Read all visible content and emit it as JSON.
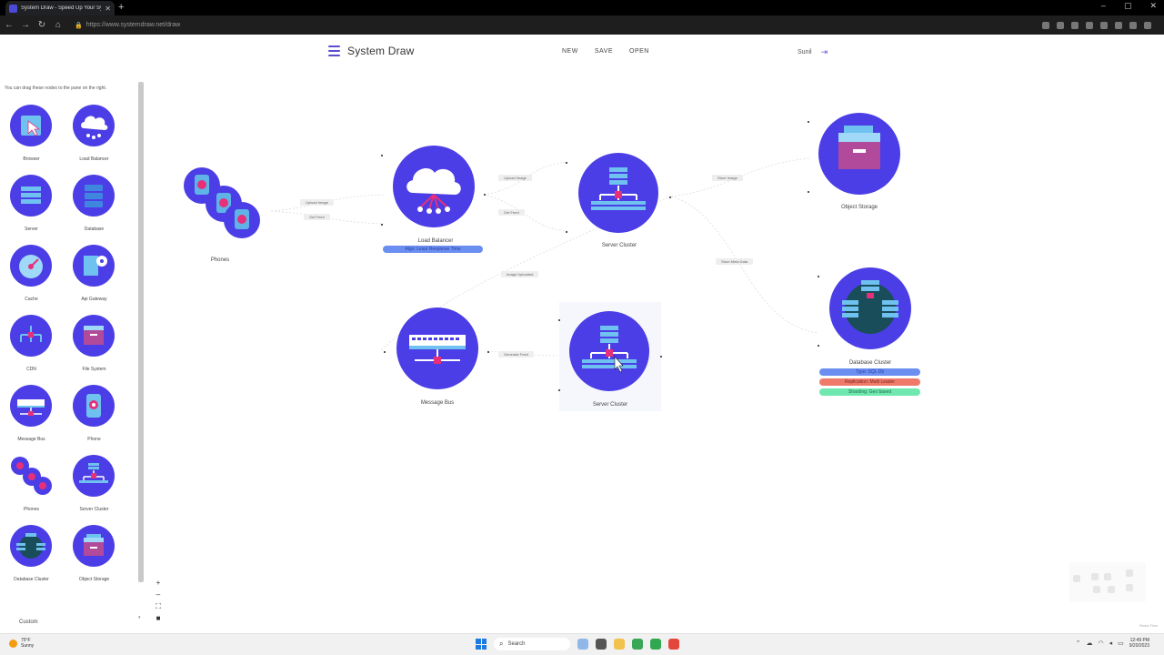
{
  "browser": {
    "tab_title": "System Draw - Speed Up Your Sy",
    "url": "https://www.systemdraw.net/draw",
    "new_tab": "+",
    "minimize": "–",
    "maximize": "▢",
    "close": "✕",
    "tab_close": "✕",
    "back": "←",
    "forward": "→",
    "reload": "↻",
    "home": "⌂"
  },
  "header": {
    "app_name": "System Draw",
    "menu": {
      "new": "NEW",
      "save": "SAVE",
      "open": "OPEN"
    },
    "user": "Sunil",
    "logout_icon": "⇥"
  },
  "sidebar": {
    "hint": "You can drag these nodes to the pane on the right.",
    "items": [
      {
        "label": "Browser",
        "icon": "browser-icon"
      },
      {
        "label": "Load Balancer",
        "icon": "cloud-icon"
      },
      {
        "label": "Server",
        "icon": "server-icon"
      },
      {
        "label": "Database",
        "icon": "database-icon"
      },
      {
        "label": "Cache",
        "icon": "gauge-icon"
      },
      {
        "label": "Api Gateway",
        "icon": "gear-icon"
      },
      {
        "label": "CDN",
        "icon": "network-icon"
      },
      {
        "label": "File System",
        "icon": "folder-icon"
      },
      {
        "label": "Message Bus",
        "icon": "bus-icon"
      },
      {
        "label": "Phone",
        "icon": "phone-icon"
      },
      {
        "label": "Phones",
        "icon": "phones-icon"
      },
      {
        "label": "Server Cluster",
        "icon": "cluster-icon"
      },
      {
        "label": "Database Cluster",
        "icon": "db-cluster-icon"
      },
      {
        "label": "Object Storage",
        "icon": "storage-icon"
      }
    ],
    "custom": "Custom"
  },
  "canvas": {
    "nodes": {
      "phones": "Phones",
      "load_balancer": "Load Balancer",
      "lb_tag": "Algo: Least Response Time",
      "server_cluster_1": "Server Cluster",
      "object_storage": "Object Storage",
      "message_bus": "Message Bus",
      "server_cluster_2": "Server Cluster",
      "database_cluster": "Database Cluster",
      "db_tags": {
        "type": "Type: SQL Db",
        "replication": "Replication: Multi Leader",
        "sharding": "Sharding: Geo based"
      }
    },
    "edges": {
      "phones_lb_1": "Upload Image",
      "phones_lb_2": "Get Feed",
      "lb_sc_1": "Upload Image",
      "lb_sc_2": "Get Feed",
      "sc_os": "Store Image",
      "sc_db": "Store Meta Data",
      "sc_mb": "Image Uploaded",
      "mb_sc2": "Generate Feed"
    },
    "zoom": {
      "in": "+",
      "out": "–",
      "fit": "⛶",
      "lock": "■"
    },
    "attribution": "React Flow"
  },
  "taskbar": {
    "weather_temp": "75°F",
    "weather_cond": "Sunny",
    "search": "Search",
    "time": "12:49 PM",
    "date": "9/20/2023"
  },
  "colors": {
    "node": "#4b3ee6",
    "accent": "#5a4ccf",
    "tag_blue": "#6b8ff0",
    "tag_red": "#ef7a6a",
    "tag_green": "#6fe8b0"
  }
}
